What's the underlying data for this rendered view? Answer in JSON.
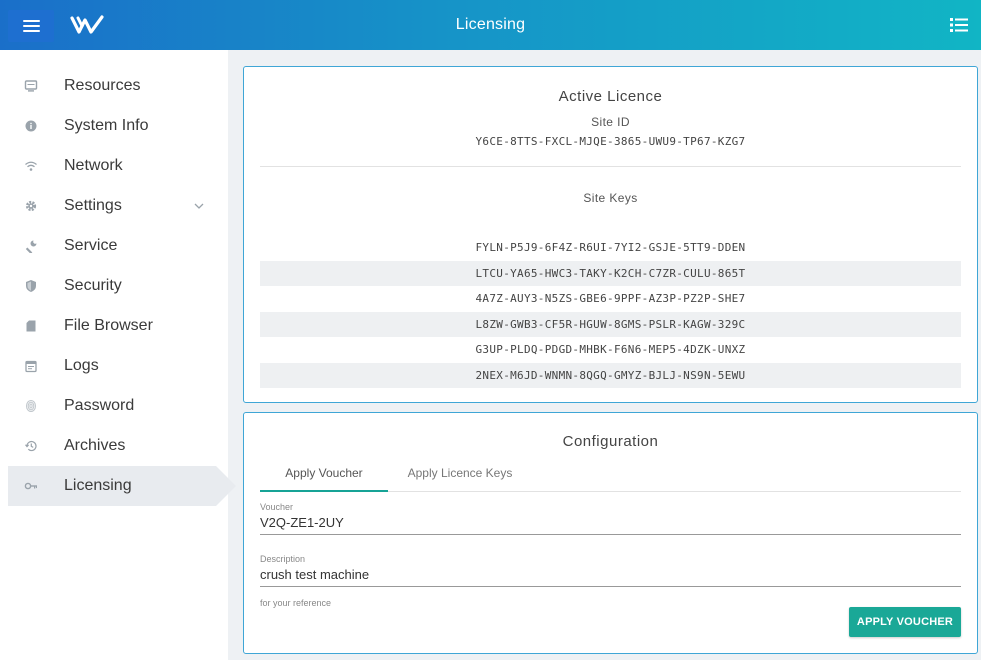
{
  "header": {
    "title": "Licensing",
    "menu_icon": "hamburger-icon",
    "logo": "w-logo",
    "right_icon": "list-icon"
  },
  "sidebar": {
    "items": [
      {
        "label": "Resources",
        "icon": "monitor-icon"
      },
      {
        "label": "System Info",
        "icon": "info-icon"
      },
      {
        "label": "Network",
        "icon": "wifi-icon"
      },
      {
        "label": "Settings",
        "icon": "gear-icon",
        "expandable": true
      },
      {
        "label": "Service",
        "icon": "wrench-icon"
      },
      {
        "label": "Security",
        "icon": "shield-icon"
      },
      {
        "label": "File Browser",
        "icon": "file-icon"
      },
      {
        "label": "Logs",
        "icon": "calendar-icon"
      },
      {
        "label": "Password",
        "icon": "fingerprint-icon"
      },
      {
        "label": "Archives",
        "icon": "history-icon"
      },
      {
        "label": "Licensing",
        "icon": "key-icon",
        "active": true
      }
    ]
  },
  "active_licence": {
    "title": "Active Licence",
    "site_id_label": "Site ID",
    "site_id": "Y6CE-8TTS-FXCL-MJQE-3865-UWU9-TP67-KZG7",
    "site_keys_label": "Site Keys",
    "site_keys": [
      "FYLN-P5J9-6F4Z-R6UI-7YI2-GSJE-5TT9-DDEN",
      "LTCU-YA65-HWC3-TAKY-K2CH-C7ZR-CULU-865T",
      "4A7Z-AUY3-N5ZS-GBE6-9PPF-AZ3P-PZ2P-SHE7",
      "L8ZW-GWB3-CF5R-HGUW-8GMS-PSLR-KAGW-329C",
      "G3UP-PLDQ-PDGD-MHBK-F6N6-MEP5-4DZK-UNXZ",
      "2NEX-M6JD-WNMN-8QGQ-GMYZ-BJLJ-NS9N-5EWU"
    ]
  },
  "configuration": {
    "title": "Configuration",
    "tabs": [
      {
        "label": "Apply Voucher",
        "active": true
      },
      {
        "label": "Apply Licence Keys",
        "active": false
      }
    ],
    "voucher_label": "Voucher",
    "voucher_value": "V2Q-ZE1-2UY",
    "description_label": "Description",
    "description_value": "crush test machine",
    "description_hint": "for your reference",
    "apply_button": "APPLY VOUCHER"
  },
  "colors": {
    "accent": "#1aa897",
    "header_start": "#1a6fc9",
    "header_end": "#11b5c5",
    "card_border": "#3fa6d6"
  }
}
